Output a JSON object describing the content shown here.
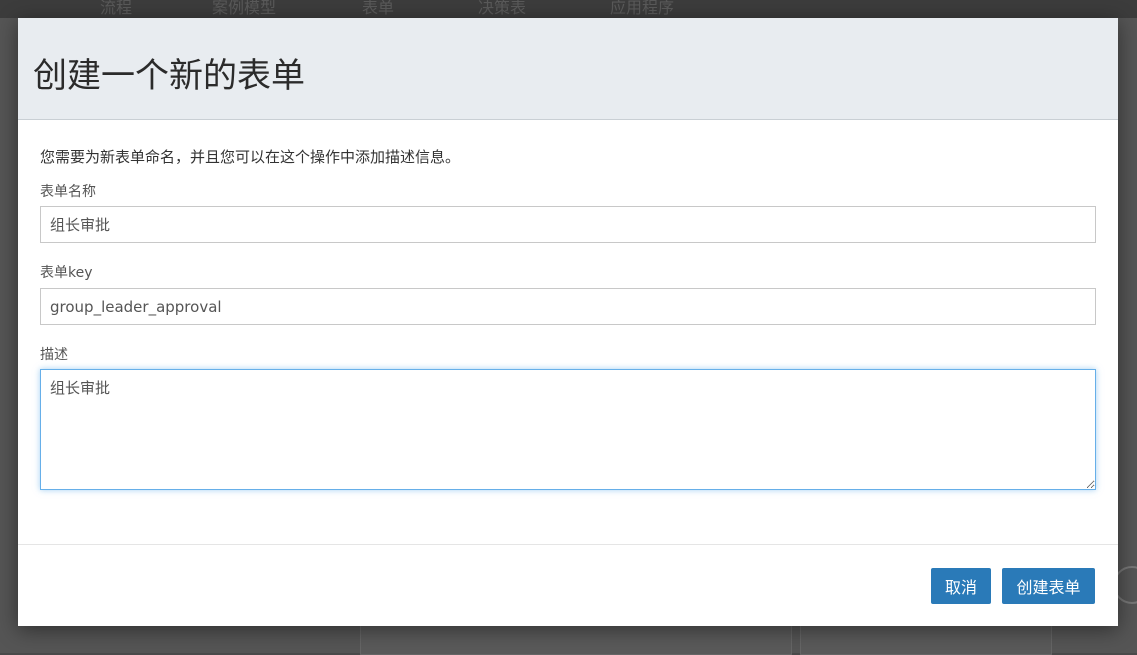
{
  "background": {
    "nav_items": [
      "流程",
      "案例模型",
      "表单",
      "决策表",
      "应用程序"
    ]
  },
  "dialog": {
    "title": "创建一个新的表单",
    "intro": "您需要为新表单命名，并且您可以在这个操作中添加描述信息。",
    "name_label": "表单名称",
    "name_value": "组长审批",
    "key_label": "表单key",
    "key_value": "group_leader_approval",
    "desc_label": "描述",
    "desc_value": "组长审批",
    "cancel_label": "取消",
    "create_label": "创建表单"
  },
  "colors": {
    "primary_button": "#2a7ab8",
    "header_bg": "#e8ecf0",
    "focus_border": "#66afe9"
  }
}
